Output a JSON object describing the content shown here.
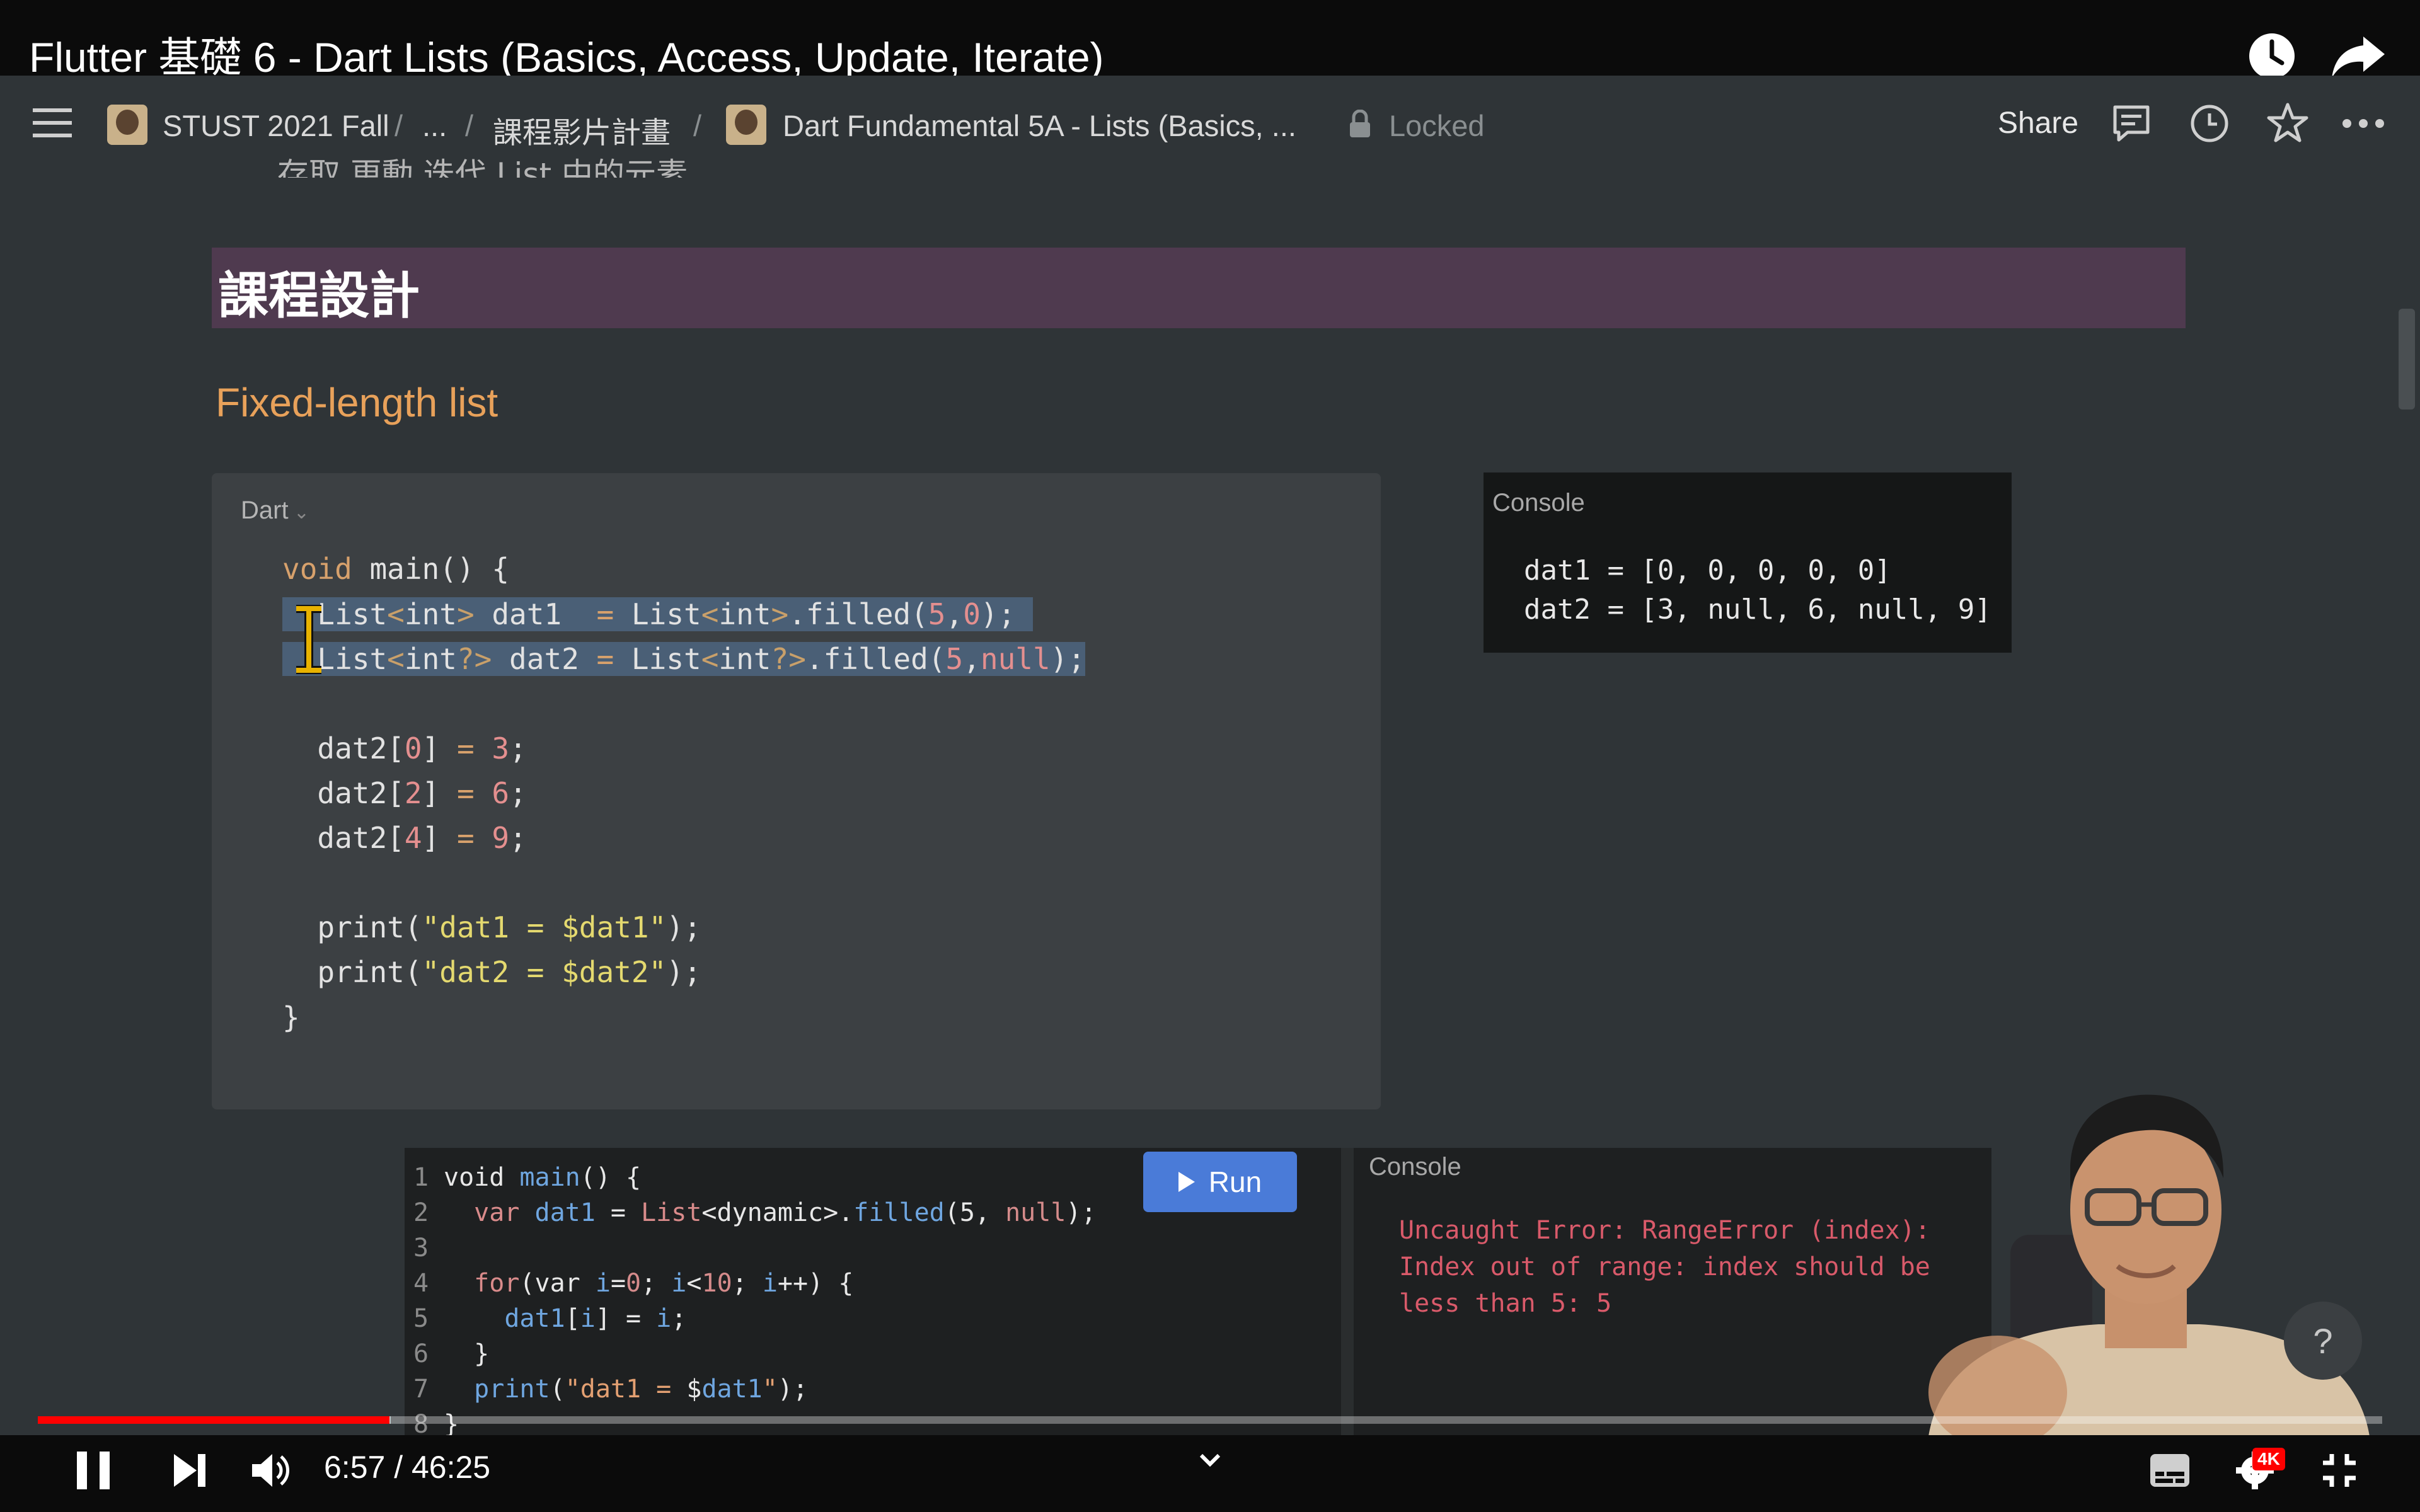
{
  "player": {
    "title": "Flutter 基礎 6 - Dart Lists (Basics, Access, Update, Iterate)",
    "time_display": "6:57 / 46:25",
    "progress_fraction": 0.15,
    "quality_badge": "4K",
    "accent_color": "#ff0000"
  },
  "notion": {
    "breadcrumb": [
      "STUST 2021 Fall",
      "...",
      "課程影片計畫",
      "Dart Fundamental 5A - Lists (Basics, ..."
    ],
    "locked_label": "Locked",
    "share_label": "Share"
  },
  "page": {
    "cut_text": "存取,更動,迭代 List 中的元素",
    "heading": "課程設計",
    "subheading": "Fixed-length list",
    "code_language": "Dart"
  },
  "console": {
    "label": "Console",
    "lines": [
      "dat1 = [0, 0, 0, 0, 0]",
      "dat2 = [3, null, 6, null, 9]"
    ]
  },
  "dartpad": {
    "run_label": "Run",
    "console_label": "Console",
    "line_numbers": [
      "1",
      "2",
      "3",
      "4",
      "5",
      "6",
      "7",
      "8"
    ],
    "error_lines": [
      "Uncaught Error: RangeError (index):",
      "Index out of range: index should be",
      "less than 5: 5"
    ]
  },
  "help": {
    "label": "?"
  }
}
